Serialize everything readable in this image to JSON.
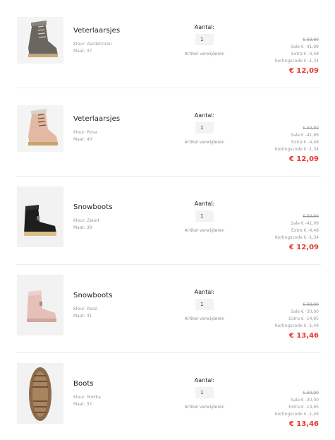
{
  "cart": {
    "items": [
      {
        "name": "Veterlaarsjes",
        "color_label": "Kleur: Aardetinten",
        "size_label": "Maat: 37",
        "quantity_label": "Aantal:",
        "quantity": "1",
        "remove_label": "Artikel verwijderen",
        "original_price": "€ 59,90",
        "sale": "Sale € -41,99",
        "extra": "Extra € -4,48",
        "coupon": "Kortingscode € -1,34",
        "final_price": "€ 12,09",
        "image_icon": "grey-lace-up-boot",
        "image_color": "#6b6660"
      },
      {
        "name": "Veterlaarsjes",
        "color_label": "Kleur: Rosa",
        "size_label": "Maat: 40",
        "quantity_label": "Aantal:",
        "quantity": "1",
        "remove_label": "Artikel verwijderen",
        "original_price": "€ 59,90",
        "sale": "Sale € -41,99",
        "extra": "Extra € -4,48",
        "coupon": "Kortingscode € -1,34",
        "final_price": "€ 12,09",
        "image_icon": "pink-lace-up-boot",
        "image_color": "#e2b9a3"
      },
      {
        "name": "Snowboots",
        "color_label": "Kleur: Zwart",
        "size_label": "Maat: 39",
        "quantity_label": "Aantal:",
        "quantity": "1",
        "remove_label": "Artikel verwijderen",
        "original_price": "€ 59,90",
        "sale": "Sale € -41,99",
        "extra": "Extra € -4,48",
        "coupon": "Kortingscode € -1,34",
        "final_price": "€ 12,09",
        "image_icon": "black-snow-boot",
        "image_color": "#1e1e1e"
      },
      {
        "name": "Snowboots",
        "color_label": "Kleur: Rosé",
        "size_label": "Maat: 41",
        "quantity_label": "Aantal:",
        "quantity": "1",
        "remove_label": "Artikel verwijderen",
        "original_price": "€ 59,90",
        "sale": "Sale € -30,00",
        "extra": "Extra € -14,95",
        "coupon": "Kortingscode € -1,49",
        "final_price": "€ 13,46",
        "image_icon": "rose-snow-boot",
        "image_color": "#e4c0b8"
      },
      {
        "name": "Boots",
        "color_label": "Kleur: Mokka",
        "size_label": "Maat: 37",
        "quantity_label": "Aantal:",
        "quantity": "1",
        "remove_label": "Artikel verwijderen",
        "original_price": "€ 59,90",
        "sale": "Sale € -30,00",
        "extra": "Extra € -14,95",
        "coupon": "Kortingscode € -1,49",
        "final_price": "€ 13,46",
        "image_icon": "mokka-boot-sole",
        "image_color": "#8a6a4a"
      }
    ]
  },
  "colors": {
    "final_price": "#e8372f",
    "muted_text": "#999999",
    "divider": "#ececec"
  }
}
